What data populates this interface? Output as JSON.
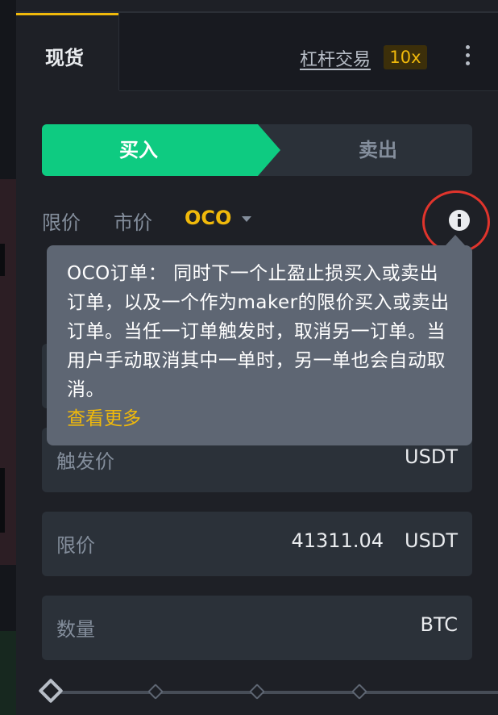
{
  "tabs": {
    "spot_label": "现货",
    "margin_label": "杠杆交易",
    "leverage_badge": "10x"
  },
  "side_toggle": {
    "buy_label": "买入",
    "sell_label": "卖出",
    "selected": "buy"
  },
  "order_types": {
    "limit": "限价",
    "market": "市价",
    "oco": "OCO",
    "selected": "OCO"
  },
  "tooltip": {
    "text": "OCO订单： 同时下一个止盈止损买入或卖出订单，以及一个作为maker的限价买入或卖出订单。当任一订单触发时，取消另一订单。当用户手动取消其中一单时，另一单也会自动取消。",
    "link": "查看更多"
  },
  "fields": {
    "trigger_price": {
      "label": "触发价",
      "unit": "USDT"
    },
    "limit_price": {
      "label": "限价",
      "value": "41311.04",
      "unit": "USDT"
    },
    "amount": {
      "label": "数量",
      "unit": "BTC"
    }
  },
  "colors": {
    "buy": "#0ecb81",
    "accent": "#f0b90b",
    "highlight_circle": "#e0342c"
  },
  "icons": [
    "more-vertical-icon",
    "caret-down-icon",
    "info-icon"
  ]
}
